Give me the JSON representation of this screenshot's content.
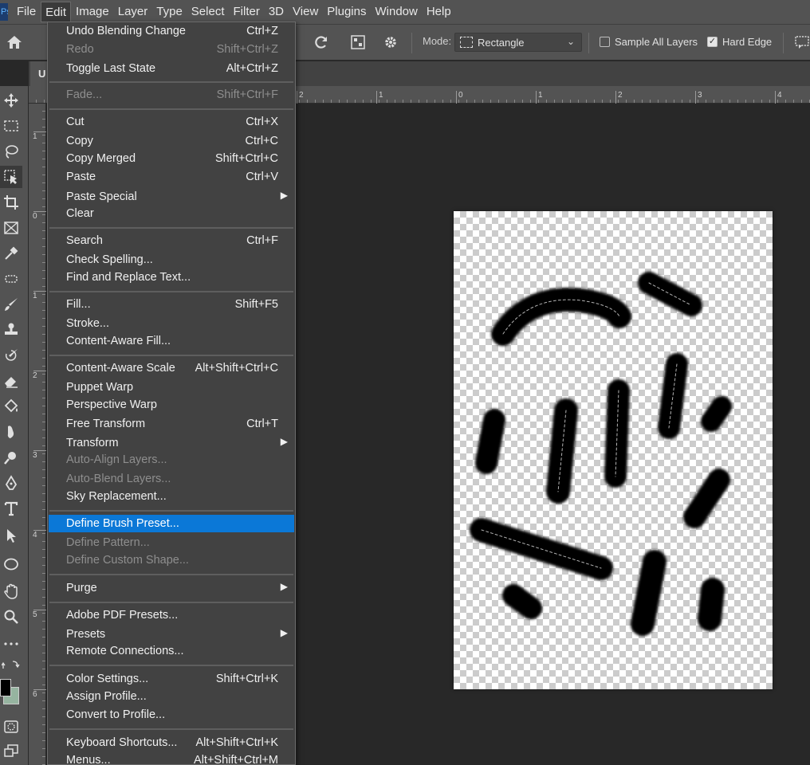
{
  "app": {
    "logo": "Ps"
  },
  "menubar": {
    "items": [
      "File",
      "Edit",
      "Image",
      "Layer",
      "Type",
      "Select",
      "Filter",
      "3D",
      "View",
      "Plugins",
      "Window",
      "Help"
    ]
  },
  "options": {
    "mode_label": "Mode:",
    "mode_value": "Rectangle",
    "sample_all_layers": "Sample All Layers",
    "sample_all_layers_checked": false,
    "hard_edge": "Hard Edge",
    "hard_edge_checked": true
  },
  "tab": {
    "title_fragment": "U"
  },
  "ruler": {
    "top": [
      "2",
      "1",
      "0",
      "1",
      "2",
      "3",
      "4"
    ],
    "left": [
      "1",
      "0",
      "1",
      "2",
      "3",
      "4",
      "5",
      "6"
    ]
  },
  "edit_menu": {
    "items": [
      {
        "label": "Undo Blending Change",
        "shortcut": "Ctrl+Z"
      },
      {
        "label": "Redo",
        "shortcut": "Shift+Ctrl+Z",
        "disabled": true
      },
      {
        "label": "Toggle Last State",
        "shortcut": "Alt+Ctrl+Z"
      },
      {
        "label": "Fade...",
        "shortcut": "Shift+Ctrl+F",
        "disabled": true
      },
      {
        "label": "Cut",
        "shortcut": "Ctrl+X"
      },
      {
        "label": "Copy",
        "shortcut": "Ctrl+C"
      },
      {
        "label": "Copy Merged",
        "shortcut": "Shift+Ctrl+C"
      },
      {
        "label": "Paste",
        "shortcut": "Ctrl+V"
      },
      {
        "label": "Paste Special",
        "shortcut": ""
      },
      {
        "label": "Clear",
        "shortcut": ""
      },
      {
        "label": "Search",
        "shortcut": "Ctrl+F"
      },
      {
        "label": "Check Spelling...",
        "shortcut": ""
      },
      {
        "label": "Find and Replace Text...",
        "shortcut": ""
      },
      {
        "label": "Fill...",
        "shortcut": "Shift+F5"
      },
      {
        "label": "Stroke...",
        "shortcut": ""
      },
      {
        "label": "Content-Aware Fill...",
        "shortcut": ""
      },
      {
        "label": "Content-Aware Scale",
        "shortcut": "Alt+Shift+Ctrl+C"
      },
      {
        "label": "Puppet Warp",
        "shortcut": ""
      },
      {
        "label": "Perspective Warp",
        "shortcut": ""
      },
      {
        "label": "Free Transform",
        "shortcut": "Ctrl+T"
      },
      {
        "label": "Transform",
        "shortcut": ""
      },
      {
        "label": "Auto-Align Layers...",
        "shortcut": "",
        "disabled": true
      },
      {
        "label": "Auto-Blend Layers...",
        "shortcut": "",
        "disabled": true
      },
      {
        "label": "Sky Replacement...",
        "shortcut": ""
      },
      {
        "label": "Define Brush Preset...",
        "shortcut": "",
        "highlighted": true
      },
      {
        "label": "Define Pattern...",
        "shortcut": "",
        "disabled": true
      },
      {
        "label": "Define Custom Shape...",
        "shortcut": "",
        "disabled": true
      },
      {
        "label": "Purge",
        "shortcut": ""
      },
      {
        "label": "Adobe PDF Presets...",
        "shortcut": ""
      },
      {
        "label": "Presets",
        "shortcut": ""
      },
      {
        "label": "Remote Connections...",
        "shortcut": ""
      },
      {
        "label": "Color Settings...",
        "shortcut": "Shift+Ctrl+K"
      },
      {
        "label": "Assign Profile...",
        "shortcut": ""
      },
      {
        "label": "Convert to Profile...",
        "shortcut": ""
      },
      {
        "label": "Keyboard Shortcuts...",
        "shortcut": "Alt+Shift+Ctrl+K"
      },
      {
        "label": "Menus...",
        "shortcut": "Alt+Shift+Ctrl+M"
      }
    ]
  },
  "colors": {
    "foreground": "#000000",
    "background": "#96b4a0",
    "highlight": "#0b78d7",
    "menu_bg": "#424242"
  },
  "icons": {
    "toolbar": [
      "move-icon",
      "marquee-icon",
      "lasso-icon",
      "object-select-icon",
      "crop-icon",
      "frame-icon",
      "eyedropper-icon",
      "healing-icon",
      "brush-icon",
      "stamp-icon",
      "history-brush-icon",
      "eraser-icon",
      "paint-bucket-icon",
      "smudge-icon",
      "dodge-icon",
      "pen-icon",
      "type-icon",
      "path-select-icon",
      "ellipse-icon",
      "hand-icon",
      "zoom-icon",
      "more-tools-icon"
    ]
  }
}
